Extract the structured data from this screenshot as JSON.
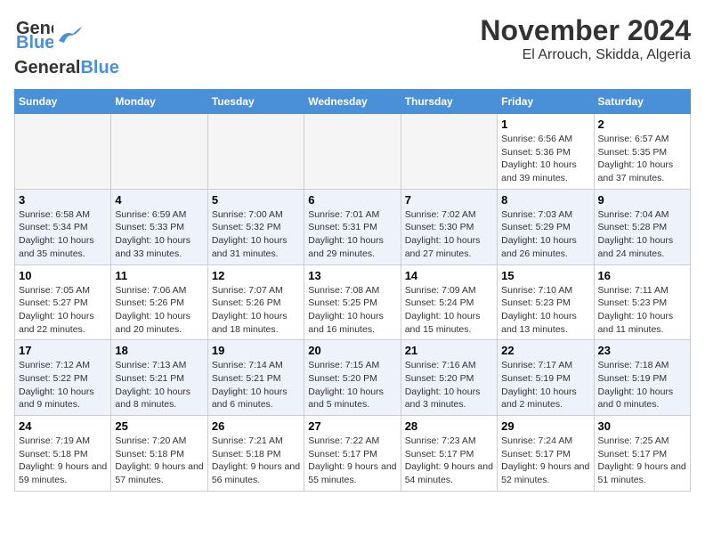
{
  "header": {
    "logo_line1": "General",
    "logo_line2": "Blue",
    "month": "November 2024",
    "location": "El Arrouch, Skidda, Algeria"
  },
  "weekdays": [
    "Sunday",
    "Monday",
    "Tuesday",
    "Wednesday",
    "Thursday",
    "Friday",
    "Saturday"
  ],
  "weeks": [
    [
      {
        "day": "",
        "info": ""
      },
      {
        "day": "",
        "info": ""
      },
      {
        "day": "",
        "info": ""
      },
      {
        "day": "",
        "info": ""
      },
      {
        "day": "",
        "info": ""
      },
      {
        "day": "1",
        "info": "Sunrise: 6:56 AM\nSunset: 5:36 PM\nDaylight: 10 hours and 39 minutes."
      },
      {
        "day": "2",
        "info": "Sunrise: 6:57 AM\nSunset: 5:35 PM\nDaylight: 10 hours and 37 minutes."
      }
    ],
    [
      {
        "day": "3",
        "info": "Sunrise: 6:58 AM\nSunset: 5:34 PM\nDaylight: 10 hours and 35 minutes."
      },
      {
        "day": "4",
        "info": "Sunrise: 6:59 AM\nSunset: 5:33 PM\nDaylight: 10 hours and 33 minutes."
      },
      {
        "day": "5",
        "info": "Sunrise: 7:00 AM\nSunset: 5:32 PM\nDaylight: 10 hours and 31 minutes."
      },
      {
        "day": "6",
        "info": "Sunrise: 7:01 AM\nSunset: 5:31 PM\nDaylight: 10 hours and 29 minutes."
      },
      {
        "day": "7",
        "info": "Sunrise: 7:02 AM\nSunset: 5:30 PM\nDaylight: 10 hours and 27 minutes."
      },
      {
        "day": "8",
        "info": "Sunrise: 7:03 AM\nSunset: 5:29 PM\nDaylight: 10 hours and 26 minutes."
      },
      {
        "day": "9",
        "info": "Sunrise: 7:04 AM\nSunset: 5:28 PM\nDaylight: 10 hours and 24 minutes."
      }
    ],
    [
      {
        "day": "10",
        "info": "Sunrise: 7:05 AM\nSunset: 5:27 PM\nDaylight: 10 hours and 22 minutes."
      },
      {
        "day": "11",
        "info": "Sunrise: 7:06 AM\nSunset: 5:26 PM\nDaylight: 10 hours and 20 minutes."
      },
      {
        "day": "12",
        "info": "Sunrise: 7:07 AM\nSunset: 5:26 PM\nDaylight: 10 hours and 18 minutes."
      },
      {
        "day": "13",
        "info": "Sunrise: 7:08 AM\nSunset: 5:25 PM\nDaylight: 10 hours and 16 minutes."
      },
      {
        "day": "14",
        "info": "Sunrise: 7:09 AM\nSunset: 5:24 PM\nDaylight: 10 hours and 15 minutes."
      },
      {
        "day": "15",
        "info": "Sunrise: 7:10 AM\nSunset: 5:23 PM\nDaylight: 10 hours and 13 minutes."
      },
      {
        "day": "16",
        "info": "Sunrise: 7:11 AM\nSunset: 5:23 PM\nDaylight: 10 hours and 11 minutes."
      }
    ],
    [
      {
        "day": "17",
        "info": "Sunrise: 7:12 AM\nSunset: 5:22 PM\nDaylight: 10 hours and 9 minutes."
      },
      {
        "day": "18",
        "info": "Sunrise: 7:13 AM\nSunset: 5:21 PM\nDaylight: 10 hours and 8 minutes."
      },
      {
        "day": "19",
        "info": "Sunrise: 7:14 AM\nSunset: 5:21 PM\nDaylight: 10 hours and 6 minutes."
      },
      {
        "day": "20",
        "info": "Sunrise: 7:15 AM\nSunset: 5:20 PM\nDaylight: 10 hours and 5 minutes."
      },
      {
        "day": "21",
        "info": "Sunrise: 7:16 AM\nSunset: 5:20 PM\nDaylight: 10 hours and 3 minutes."
      },
      {
        "day": "22",
        "info": "Sunrise: 7:17 AM\nSunset: 5:19 PM\nDaylight: 10 hours and 2 minutes."
      },
      {
        "day": "23",
        "info": "Sunrise: 7:18 AM\nSunset: 5:19 PM\nDaylight: 10 hours and 0 minutes."
      }
    ],
    [
      {
        "day": "24",
        "info": "Sunrise: 7:19 AM\nSunset: 5:18 PM\nDaylight: 9 hours and 59 minutes."
      },
      {
        "day": "25",
        "info": "Sunrise: 7:20 AM\nSunset: 5:18 PM\nDaylight: 9 hours and 57 minutes."
      },
      {
        "day": "26",
        "info": "Sunrise: 7:21 AM\nSunset: 5:18 PM\nDaylight: 9 hours and 56 minutes."
      },
      {
        "day": "27",
        "info": "Sunrise: 7:22 AM\nSunset: 5:17 PM\nDaylight: 9 hours and 55 minutes."
      },
      {
        "day": "28",
        "info": "Sunrise: 7:23 AM\nSunset: 5:17 PM\nDaylight: 9 hours and 54 minutes."
      },
      {
        "day": "29",
        "info": "Sunrise: 7:24 AM\nSunset: 5:17 PM\nDaylight: 9 hours and 52 minutes."
      },
      {
        "day": "30",
        "info": "Sunrise: 7:25 AM\nSunset: 5:17 PM\nDaylight: 9 hours and 51 minutes."
      }
    ]
  ]
}
